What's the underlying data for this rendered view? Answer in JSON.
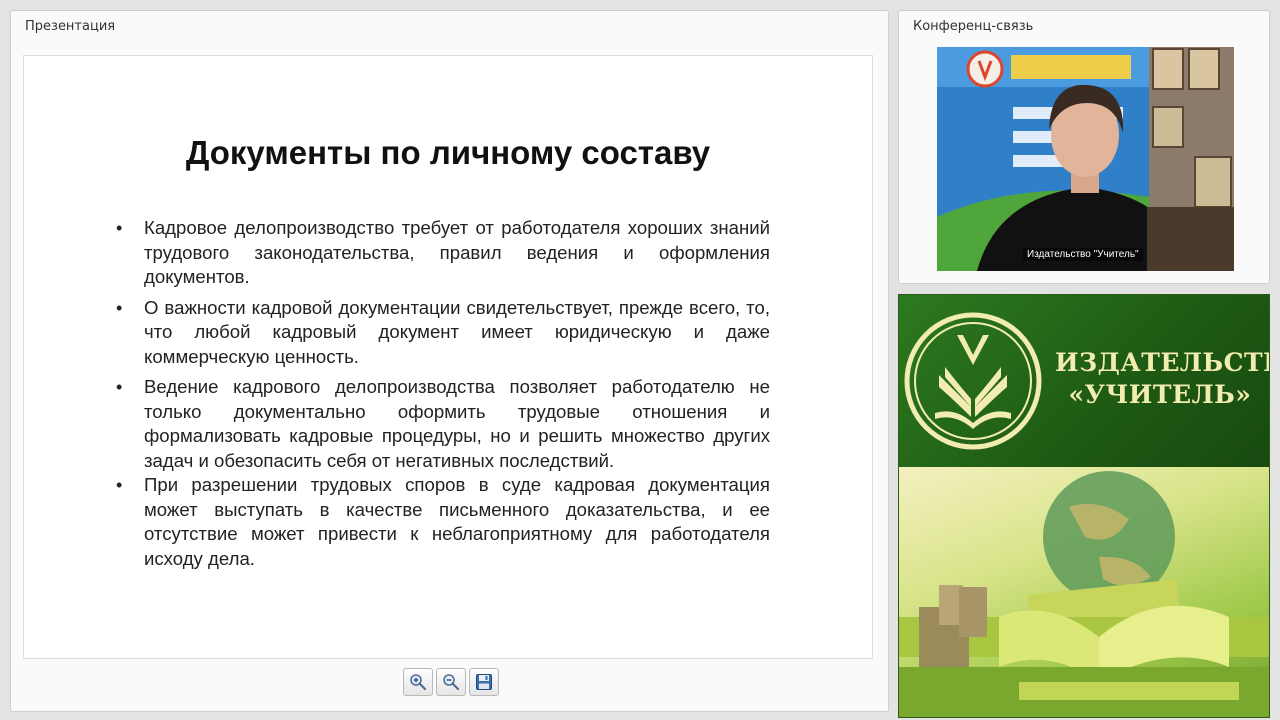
{
  "presentation": {
    "panel_title": "Презентация",
    "slide": {
      "title": "Документы по личному составу",
      "bullets": [
        "Кадровое делопроизводство требует от работодателя хороших знаний трудового законодательства, правил ведения и оформления документов.",
        "О важности кадровой документации свидетельствует, прежде всего, то, что любой кадровый документ имеет юридическую и даже коммерческую ценность.",
        "Ведение кадрового делопроизводства позволяет работодателю не только документально оформить трудовые отношения и формализовать кадровые процедуры, но и решить множество других задач и обезопасить себя от негативных последствий.",
        "При разрешении трудовых споров в суде кадровая документация может выступать в качестве письменного доказательства, и ее отсутствие может привести к неблагоприятному для работодателя исходу дела."
      ]
    },
    "toolbar": {
      "zoom_in_icon": "zoom-in-icon",
      "zoom_out_icon": "zoom-out-icon",
      "save_icon": "floppy-disk-icon"
    }
  },
  "conference": {
    "panel_title": "Конференц-связь",
    "video_caption": "Издательство \"Учитель\""
  },
  "logo": {
    "line1": "ИЗДАТЕЛЬСТВО",
    "line2": "«УЧИТЕЛЬ»",
    "colors": {
      "green": "#1f5c14",
      "gold": "#f2ecb0"
    }
  }
}
